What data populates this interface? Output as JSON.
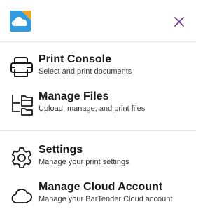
{
  "header": {
    "logo_icon": "bartender-cloud-logo-icon",
    "close_icon": "close-icon",
    "accent_color": "#6b2fa0"
  },
  "menu": {
    "primary_items": [
      {
        "title": "Print Console",
        "description": "Select and print documents",
        "icon": "printer-icon"
      },
      {
        "title": "Manage Files",
        "description": "Upload, manage, and print files",
        "icon": "folder-tree-icon"
      }
    ],
    "secondary_items": [
      {
        "title": "Settings",
        "description": "Manage your print settings",
        "icon": "gear-icon"
      },
      {
        "title": "Manage Cloud Account",
        "description": "Manage your BarTender Cloud account",
        "icon": "cloud-icon"
      }
    ]
  },
  "colors": {
    "logo_blue": "#2f9be0",
    "logo_orange": "#f3a321",
    "divider": "#e3e3e3",
    "text": "#1a1a1a"
  }
}
